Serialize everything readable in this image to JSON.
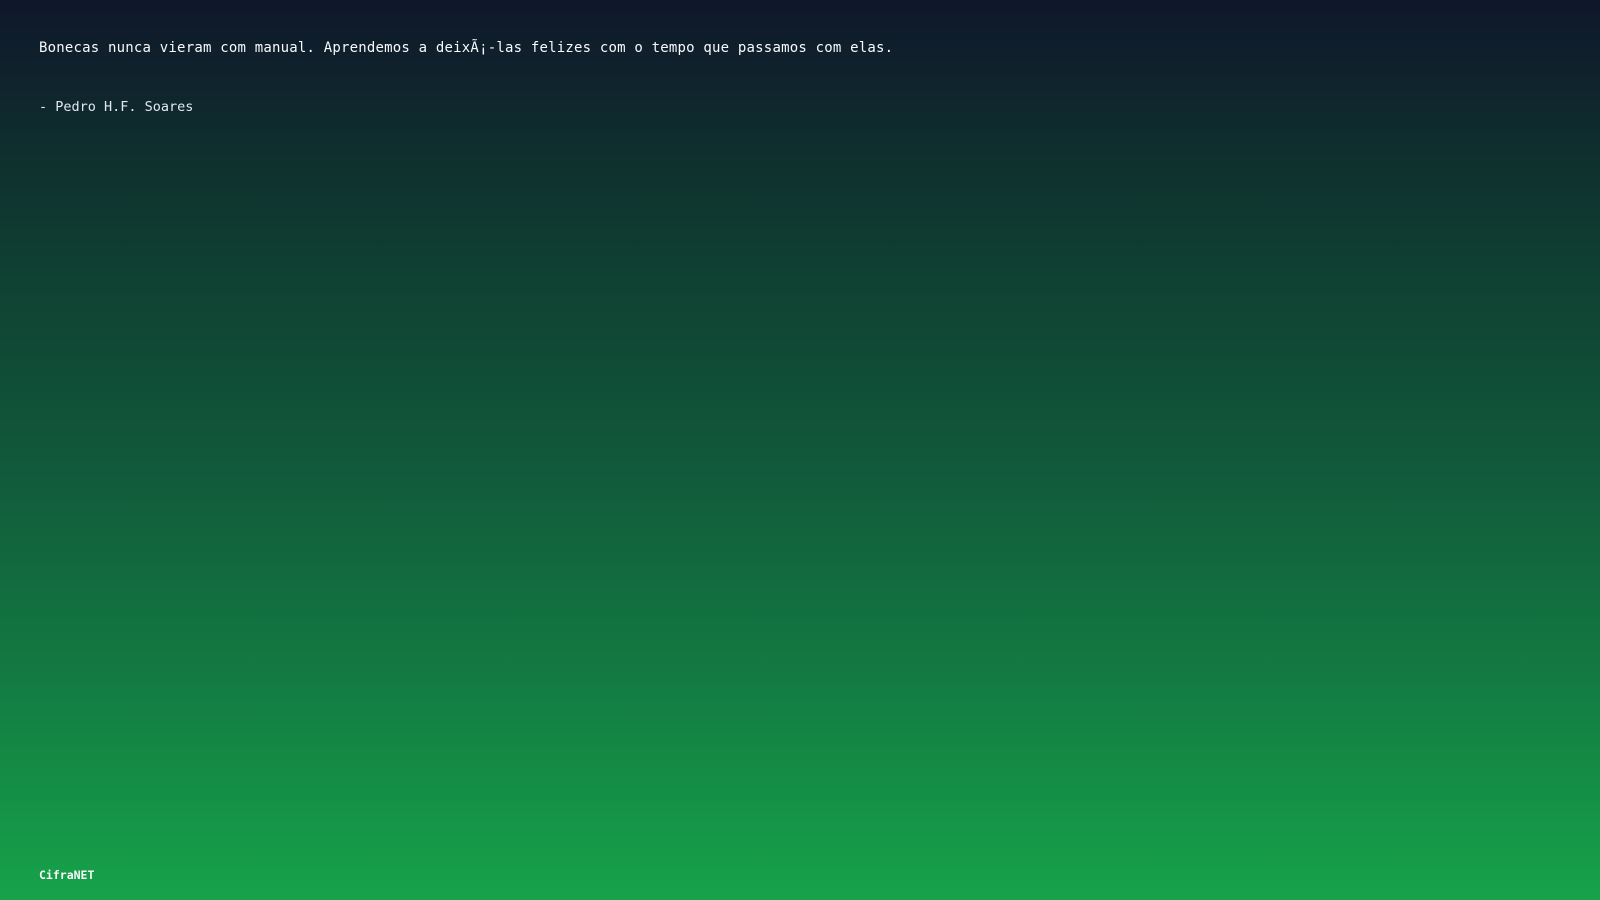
{
  "quote": {
    "text": "Bonecas nunca vieram com manual. Aprendemos a deixÃ¡-las felizes com o tempo que passamos com elas.",
    "author": "- Pedro H.F. Soares"
  },
  "footer": {
    "brand": "CifraNET"
  },
  "colors": {
    "background_top": "#0f172a",
    "background_bottom": "#16a34a",
    "text": "#f8fafc"
  }
}
